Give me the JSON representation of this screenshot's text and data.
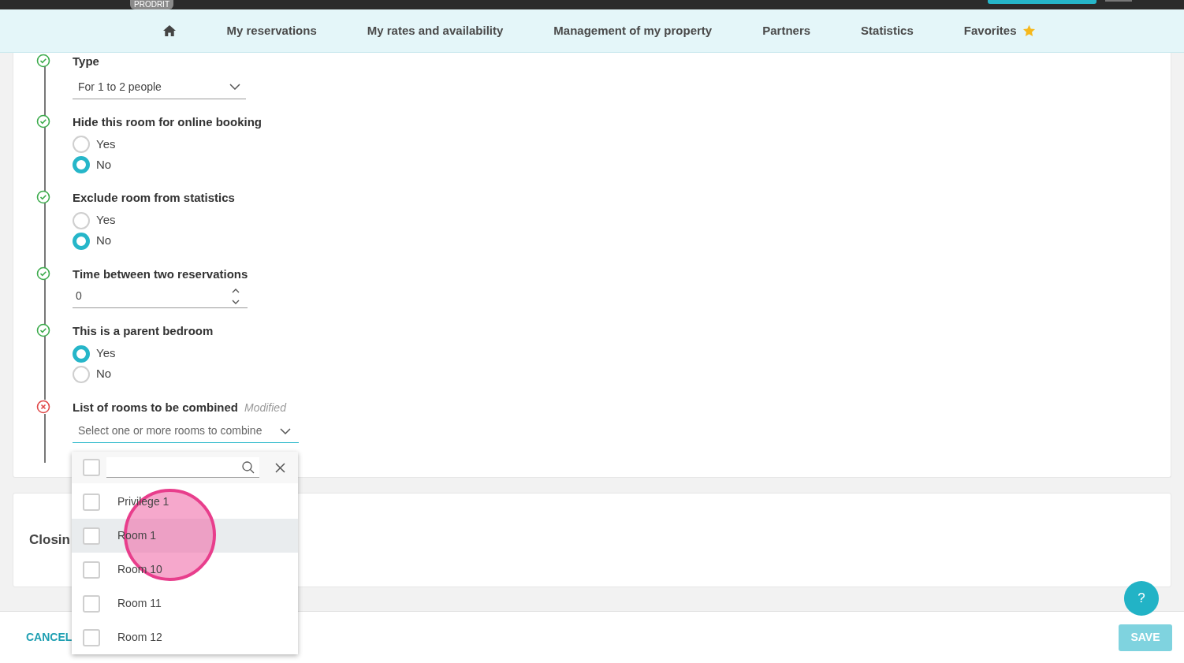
{
  "top_bar": {
    "badge": "PRODRIT"
  },
  "nav": {
    "items": [
      {
        "kind": "home"
      },
      {
        "kind": "link",
        "label": "My reservations"
      },
      {
        "kind": "link",
        "label": "My rates and availability"
      },
      {
        "kind": "link",
        "label": "Management of my property"
      },
      {
        "kind": "link",
        "label": "Partners"
      },
      {
        "kind": "link",
        "label": "Statistics"
      },
      {
        "kind": "favorites",
        "label": "Favorites"
      }
    ]
  },
  "steps": [
    {
      "valid": true,
      "kind": "select",
      "label": "Type",
      "value": "For 1 to 2 people"
    },
    {
      "valid": true,
      "kind": "radio",
      "label": "Hide this room for online booking",
      "options": [
        {
          "label": "Yes",
          "selected": false
        },
        {
          "label": "No",
          "selected": true
        }
      ]
    },
    {
      "valid": true,
      "kind": "radio",
      "label": "Exclude room from statistics",
      "options": [
        {
          "label": "Yes",
          "selected": false
        },
        {
          "label": "No",
          "selected": true
        }
      ]
    },
    {
      "valid": true,
      "kind": "number",
      "label": "Time between two reservations",
      "value": "0"
    },
    {
      "valid": true,
      "kind": "radio",
      "label": "This is a parent bedroom",
      "options": [
        {
          "label": "Yes",
          "selected": true
        },
        {
          "label": "No",
          "selected": false
        }
      ]
    },
    {
      "valid": false,
      "kind": "multiselect",
      "label": "List of rooms to be combined",
      "note": "Modified",
      "placeholder": "Select one or more rooms to combine"
    }
  ],
  "dropdown": {
    "select_all_checked": false,
    "options": [
      {
        "label": "Privilege 1",
        "checked": false,
        "selected": false
      },
      {
        "label": "Room 1",
        "checked": false,
        "selected": true
      },
      {
        "label": "Room 10",
        "checked": false,
        "selected": false
      },
      {
        "label": "Room 11",
        "checked": false,
        "selected": false
      },
      {
        "label": "Room 12",
        "checked": false,
        "selected": false
      }
    ]
  },
  "closing_section": {
    "title": "Closin"
  },
  "footer": {
    "cancel": "CANCEL",
    "save": "SAVE",
    "help": "?"
  }
}
